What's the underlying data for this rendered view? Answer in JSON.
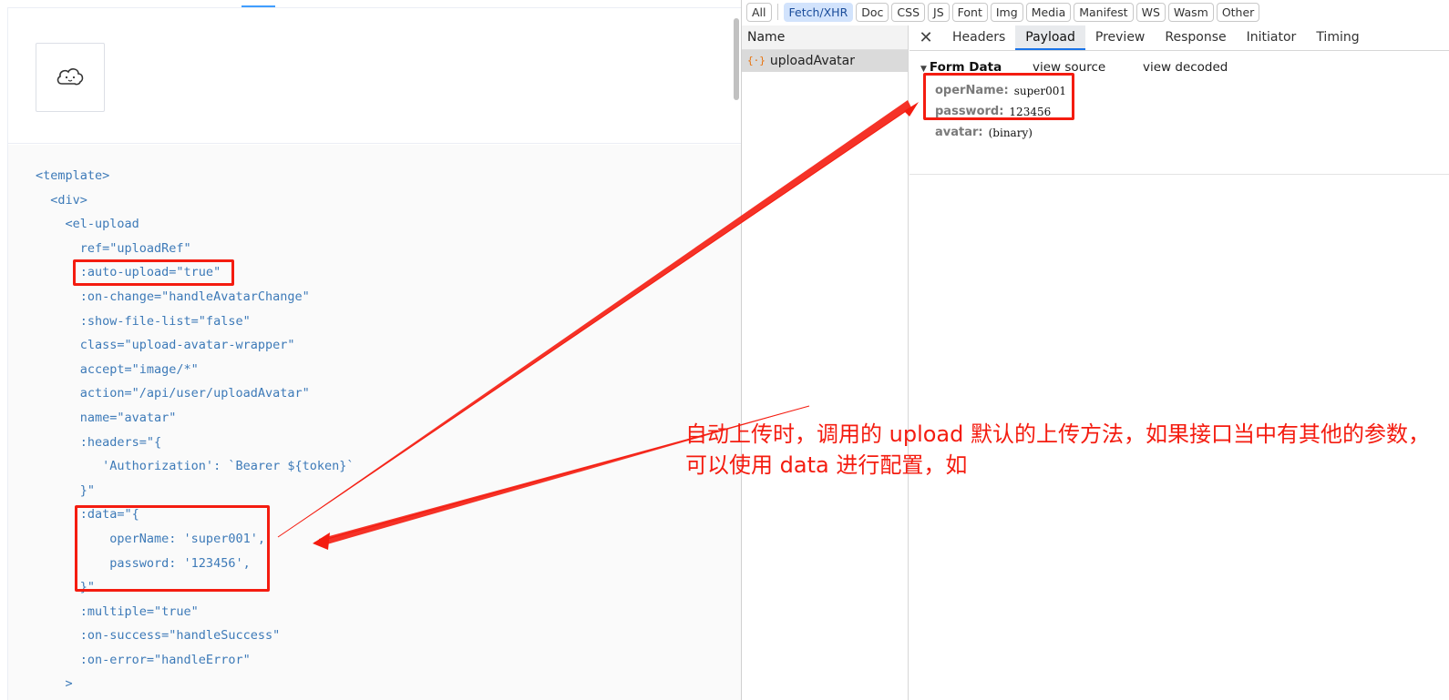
{
  "docs": {
    "avatar_icon": "cloud-face-icon",
    "code_lines": [
      "<template>",
      "  <div>",
      "    <el-upload",
      "      ref=\"uploadRef\"",
      "      :auto-upload=\"true\"",
      "      :on-change=\"handleAvatarChange\"",
      "      :show-file-list=\"false\"",
      "      class=\"upload-avatar-wrapper\"",
      "      accept=\"image/*\"",
      "      action=\"/api/user/uploadAvatar\"",
      "      name=\"avatar\"",
      "      :headers=\"{",
      "         'Authorization': `Bearer ${token}`",
      "      }\"",
      "      :data=\"{",
      "          operName: 'super001',",
      "          password: '123456',",
      "      }\"",
      "      :multiple=\"true\"",
      "      :on-success=\"handleSuccess\"",
      "      :on-error=\"handleError\"",
      "    >"
    ]
  },
  "devtools": {
    "filters": [
      {
        "label": "All",
        "active": false
      },
      {
        "label": "Fetch/XHR",
        "active": true
      },
      {
        "label": "Doc",
        "active": false
      },
      {
        "label": "CSS",
        "active": false
      },
      {
        "label": "JS",
        "active": false
      },
      {
        "label": "Font",
        "active": false
      },
      {
        "label": "Img",
        "active": false
      },
      {
        "label": "Media",
        "active": false
      },
      {
        "label": "Manifest",
        "active": false
      },
      {
        "label": "WS",
        "active": false
      },
      {
        "label": "Wasm",
        "active": false
      },
      {
        "label": "Other",
        "active": false
      }
    ],
    "name_header": "Name",
    "request_icon": "{·}",
    "request_name": "uploadAvatar",
    "close_glyph": "✕",
    "tabs": [
      "Headers",
      "Payload",
      "Preview",
      "Response",
      "Initiator",
      "Timing"
    ],
    "active_tab": "Payload",
    "form_data": {
      "title": "Form Data",
      "view_source": "view source",
      "view_decoded": "view decoded",
      "fields": [
        {
          "key": "operName:",
          "value": "super001"
        },
        {
          "key": "password:",
          "value": "123456"
        },
        {
          "key": "avatar:",
          "value": "(binary)"
        }
      ]
    }
  },
  "annotation": {
    "text": "自动上传时，调用的 upload 默认的上传方法，如果接口当中有其他的参数，可以使用 data 进行配置，如",
    "color": "#f41c10"
  }
}
